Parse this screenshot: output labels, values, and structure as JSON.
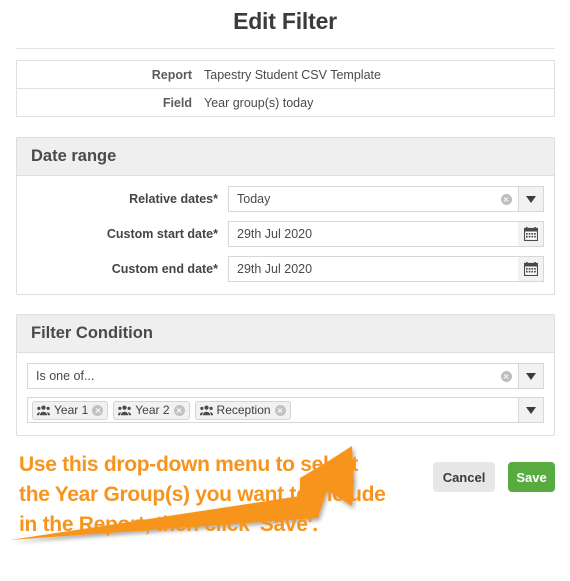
{
  "dialog": {
    "title": "Edit Filter"
  },
  "info": {
    "rows": [
      {
        "label": "Report",
        "value": "Tapestry Student CSV Template"
      },
      {
        "label": "Field",
        "value": "Year group(s) today"
      }
    ]
  },
  "date_range": {
    "header": "Date range",
    "relative_dates": {
      "label": "Relative dates*",
      "value": "Today",
      "clear_icon": "clear-circle-icon",
      "dropdown_icon": "chevron-down-icon"
    },
    "custom_start_date": {
      "label": "Custom start date*",
      "value": "29th Jul 2020",
      "calendar_icon": "calendar-icon"
    },
    "custom_end_date": {
      "label": "Custom end date*",
      "value": "29th Jul 2020",
      "calendar_icon": "calendar-icon"
    }
  },
  "filter_condition": {
    "header": "Filter Condition",
    "operator": {
      "value": "Is one of...",
      "clear_icon": "clear-circle-icon",
      "dropdown_icon": "chevron-down-icon"
    },
    "tokens": {
      "chips": [
        {
          "label": "Year 1",
          "icon": "group-icon",
          "remove_icon": "remove-circle-icon"
        },
        {
          "label": "Year 2",
          "icon": "group-icon",
          "remove_icon": "remove-circle-icon"
        },
        {
          "label": "Reception",
          "icon": "group-icon",
          "remove_icon": "remove-circle-icon"
        }
      ],
      "dropdown_icon": "chevron-down-icon"
    }
  },
  "footer": {
    "cancel_label": "Cancel",
    "save_label": "Save"
  },
  "annotation": {
    "text": "Use this drop-down menu to select the Year Group(s) you want to include in the Report, then click 'Save'.",
    "color": "#f7941e",
    "arrow_icon": "arrow-pointer-icon"
  },
  "colors": {
    "save_green": "#57ab3f",
    "cancel_grey": "#e7e7e7",
    "panel_header": "#efefef",
    "border": "#dedede",
    "annotation_orange": "#f7941e"
  }
}
